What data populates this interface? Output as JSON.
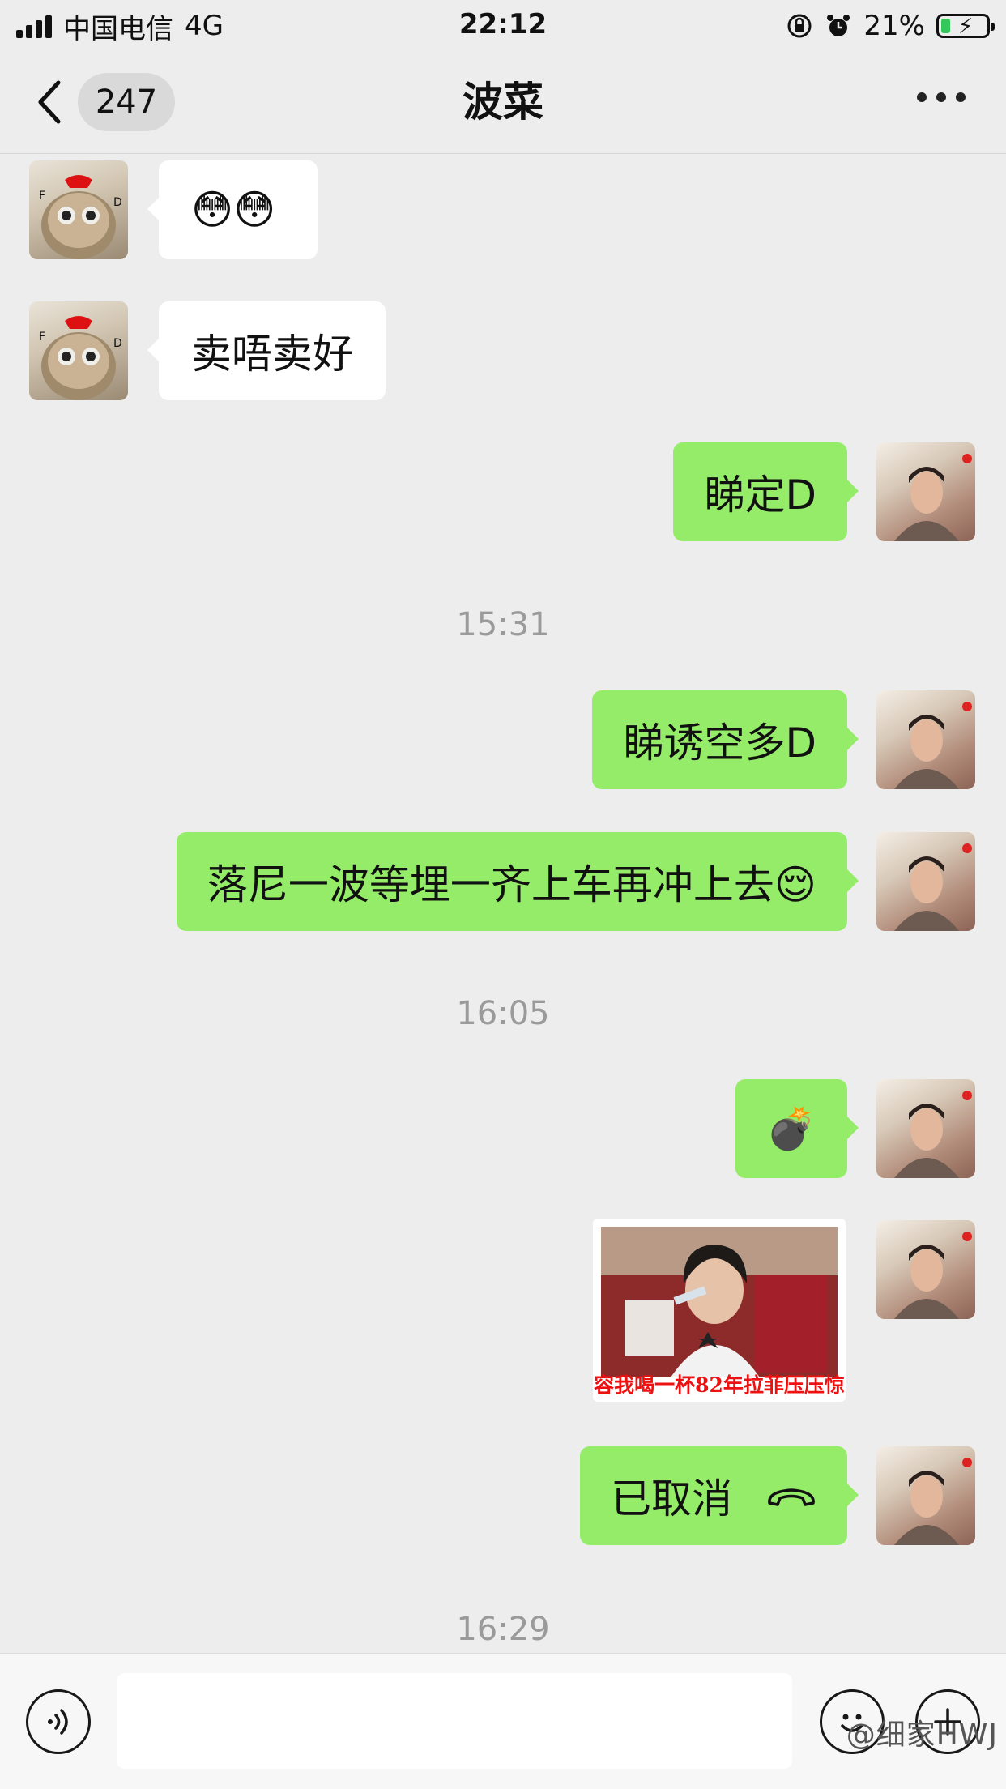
{
  "status_bar": {
    "carrier": "中国电信",
    "network": "4G",
    "time": "22:12",
    "battery_percent": "21%",
    "battery_level": 0.21,
    "icons": [
      "signal-icon",
      "orientation-lock-icon",
      "alarm-icon",
      "battery-charging-icon"
    ]
  },
  "nav": {
    "back_count": "247",
    "title": "波菜",
    "more_icon": "more-dots-icon"
  },
  "messages": [
    {
      "side": "left",
      "type": "emoji",
      "text": "😳😳",
      "avatar": "cat-avatar"
    },
    {
      "side": "left",
      "type": "text",
      "text": "卖唔卖好",
      "avatar": "cat-avatar"
    },
    {
      "side": "right",
      "type": "text",
      "text": "睇定D",
      "avatar": "self-avatar"
    },
    {
      "type": "time",
      "text": "15:31"
    },
    {
      "side": "right",
      "type": "text",
      "text": "睇诱空多D",
      "avatar": "self-avatar"
    },
    {
      "side": "right",
      "type": "text",
      "text": "落尼一波等埋一齐上车再冲上去😌",
      "avatar": "self-avatar"
    },
    {
      "type": "time",
      "text": "16:05"
    },
    {
      "side": "right",
      "type": "emoji",
      "text": "💣",
      "avatar": "self-avatar"
    },
    {
      "side": "right",
      "type": "image",
      "caption": "容我喝一杯82年拉菲压压惊",
      "avatar": "self-avatar"
    },
    {
      "side": "right",
      "type": "call",
      "text": "已取消",
      "icon": "phone-hangup-icon",
      "avatar": "self-avatar"
    },
    {
      "type": "time",
      "text": "16:29"
    }
  ],
  "input_bar": {
    "voice_icon": "voice-icon",
    "emoji_icon": "emoji-icon",
    "plus_icon": "plus-icon",
    "placeholder": ""
  },
  "watermark": "@细家HWJ",
  "colors": {
    "background": "#ededed",
    "sent_bubble": "#95ec69",
    "received_bubble": "#ffffff",
    "timestamp": "#9a9a9a"
  }
}
